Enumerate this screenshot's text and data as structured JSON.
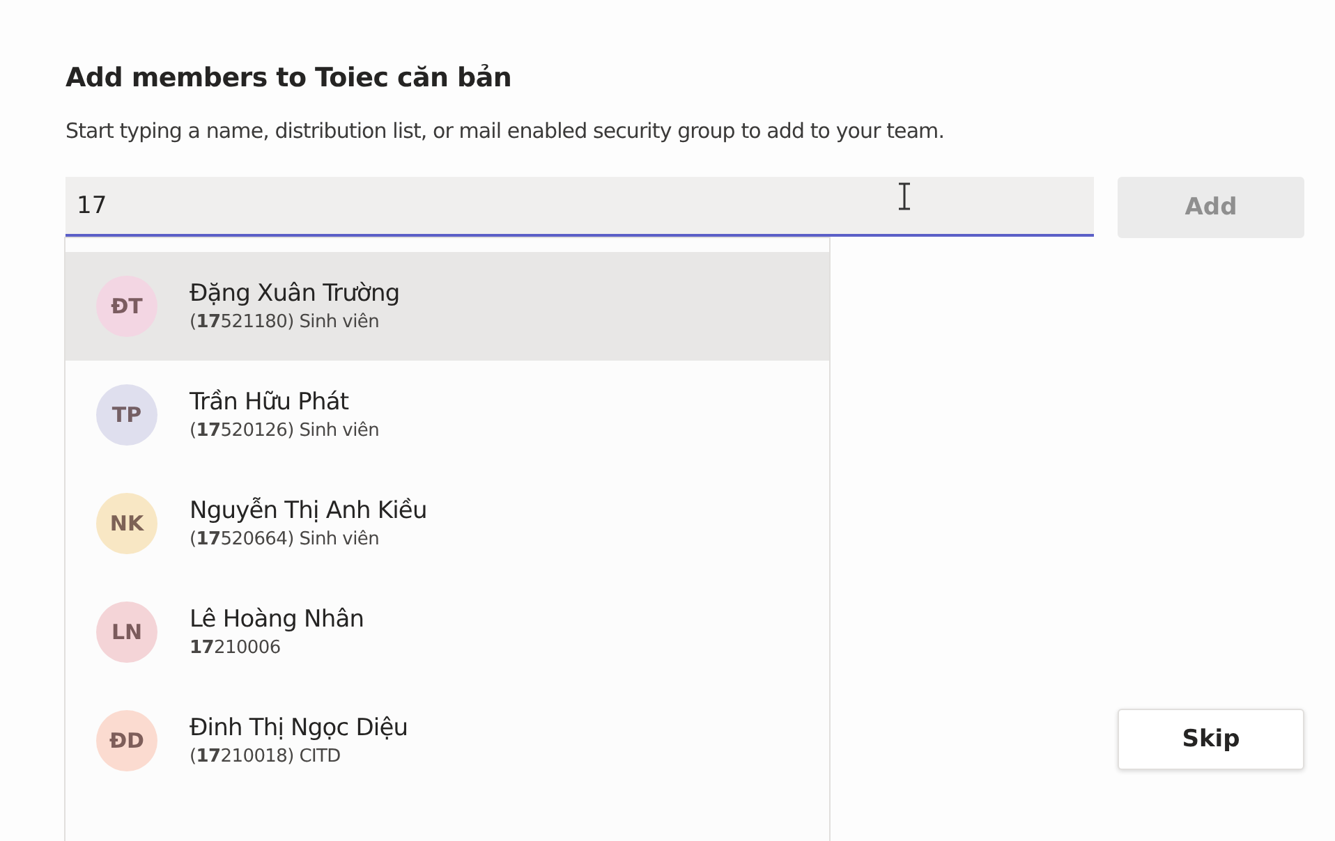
{
  "dialog": {
    "title": "Add members to Toiec căn bản",
    "description": "Start typing a name, distribution list, or mail enabled security group to add to your team."
  },
  "search": {
    "value": "17"
  },
  "add_button": {
    "label": "Add",
    "disabled": true
  },
  "suggestions": [
    {
      "initials": "ĐT",
      "color": "#f3d6e3",
      "name": "Đặng Xuân Trường",
      "detail": "(**17**521180) Sinh viên",
      "selected": true
    },
    {
      "initials": "TP",
      "color": "#dfdfee",
      "name": "Trần Hữu Phát",
      "detail": "(**17**520126) Sinh viên",
      "selected": false
    },
    {
      "initials": "NK",
      "color": "#f8e7c4",
      "name": "Nguyễn Thị Anh Kiều",
      "detail": "(**17**520664) Sinh viên",
      "selected": false
    },
    {
      "initials": "LN",
      "color": "#f4d4d7",
      "name": "Lê Hoàng Nhân",
      "detail": "**17**210006",
      "selected": false
    },
    {
      "initials": "ĐD",
      "color": "#fbdbd0",
      "name": "Đinh Thị Ngọc Diệu",
      "detail": "(**17**210018) CITD",
      "selected": false
    }
  ],
  "skip_button": {
    "label": "Skip"
  }
}
